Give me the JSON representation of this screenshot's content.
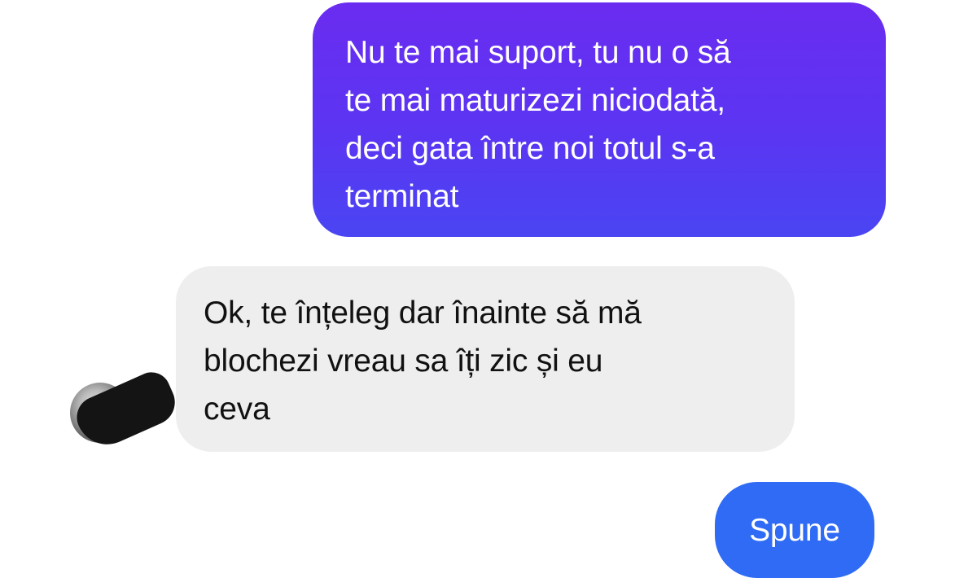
{
  "conversation": {
    "messages": [
      {
        "direction": "sent",
        "text": "Nu te mai suport, tu nu o să\nte mai maturizezi niciodată,\ndeci gata între noi totul s-a\nterminat",
        "color": "#5b35f2"
      },
      {
        "direction": "received",
        "text": "Ok, te înțeleg dar înainte să mă\nblochezi vreau sa îți zic și eu\nceva",
        "color": "#eeeeef"
      },
      {
        "direction": "sent",
        "text": "Spune",
        "color": "#2f6bf5"
      }
    ]
  },
  "avatar": {
    "icon": "contact-avatar-icon",
    "redacted": true
  }
}
